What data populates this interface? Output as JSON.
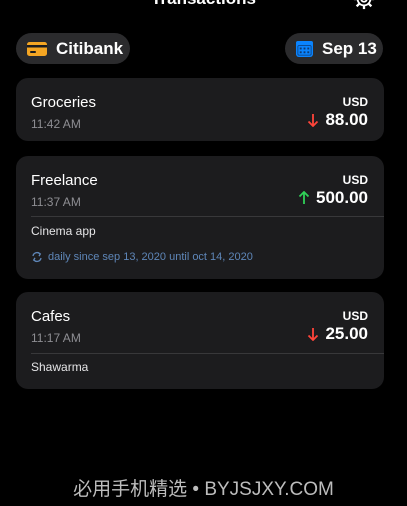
{
  "header": {
    "title": "Transactions",
    "settings_icon": "gear-icon"
  },
  "account": {
    "name": "Citibank",
    "icon": "credit-card-icon",
    "icon_color": "#f5a623"
  },
  "date": {
    "label": "Sep 13",
    "icon": "calendar-icon",
    "icon_color": "#0a84ff"
  },
  "colors": {
    "down": "#ff453a",
    "up": "#30d158",
    "recurring": "#5e86b8"
  },
  "transactions": [
    {
      "name": "Groceries",
      "time": "11:42 AM",
      "currency": "USD",
      "direction": "down",
      "amount": "88.00"
    },
    {
      "name": "Freelance",
      "time": "11:37 AM",
      "currency": "USD",
      "direction": "up",
      "amount": "500.00",
      "note": "Cinema app",
      "recurrence": "daily since sep 13, 2020 until oct 14, 2020"
    },
    {
      "name": "Cafes",
      "time": "11:17 AM",
      "currency": "USD",
      "direction": "down",
      "amount": "25.00",
      "note": "Shawarma"
    }
  ],
  "watermark": "必用手机精选 • BYJSJXY.COM"
}
